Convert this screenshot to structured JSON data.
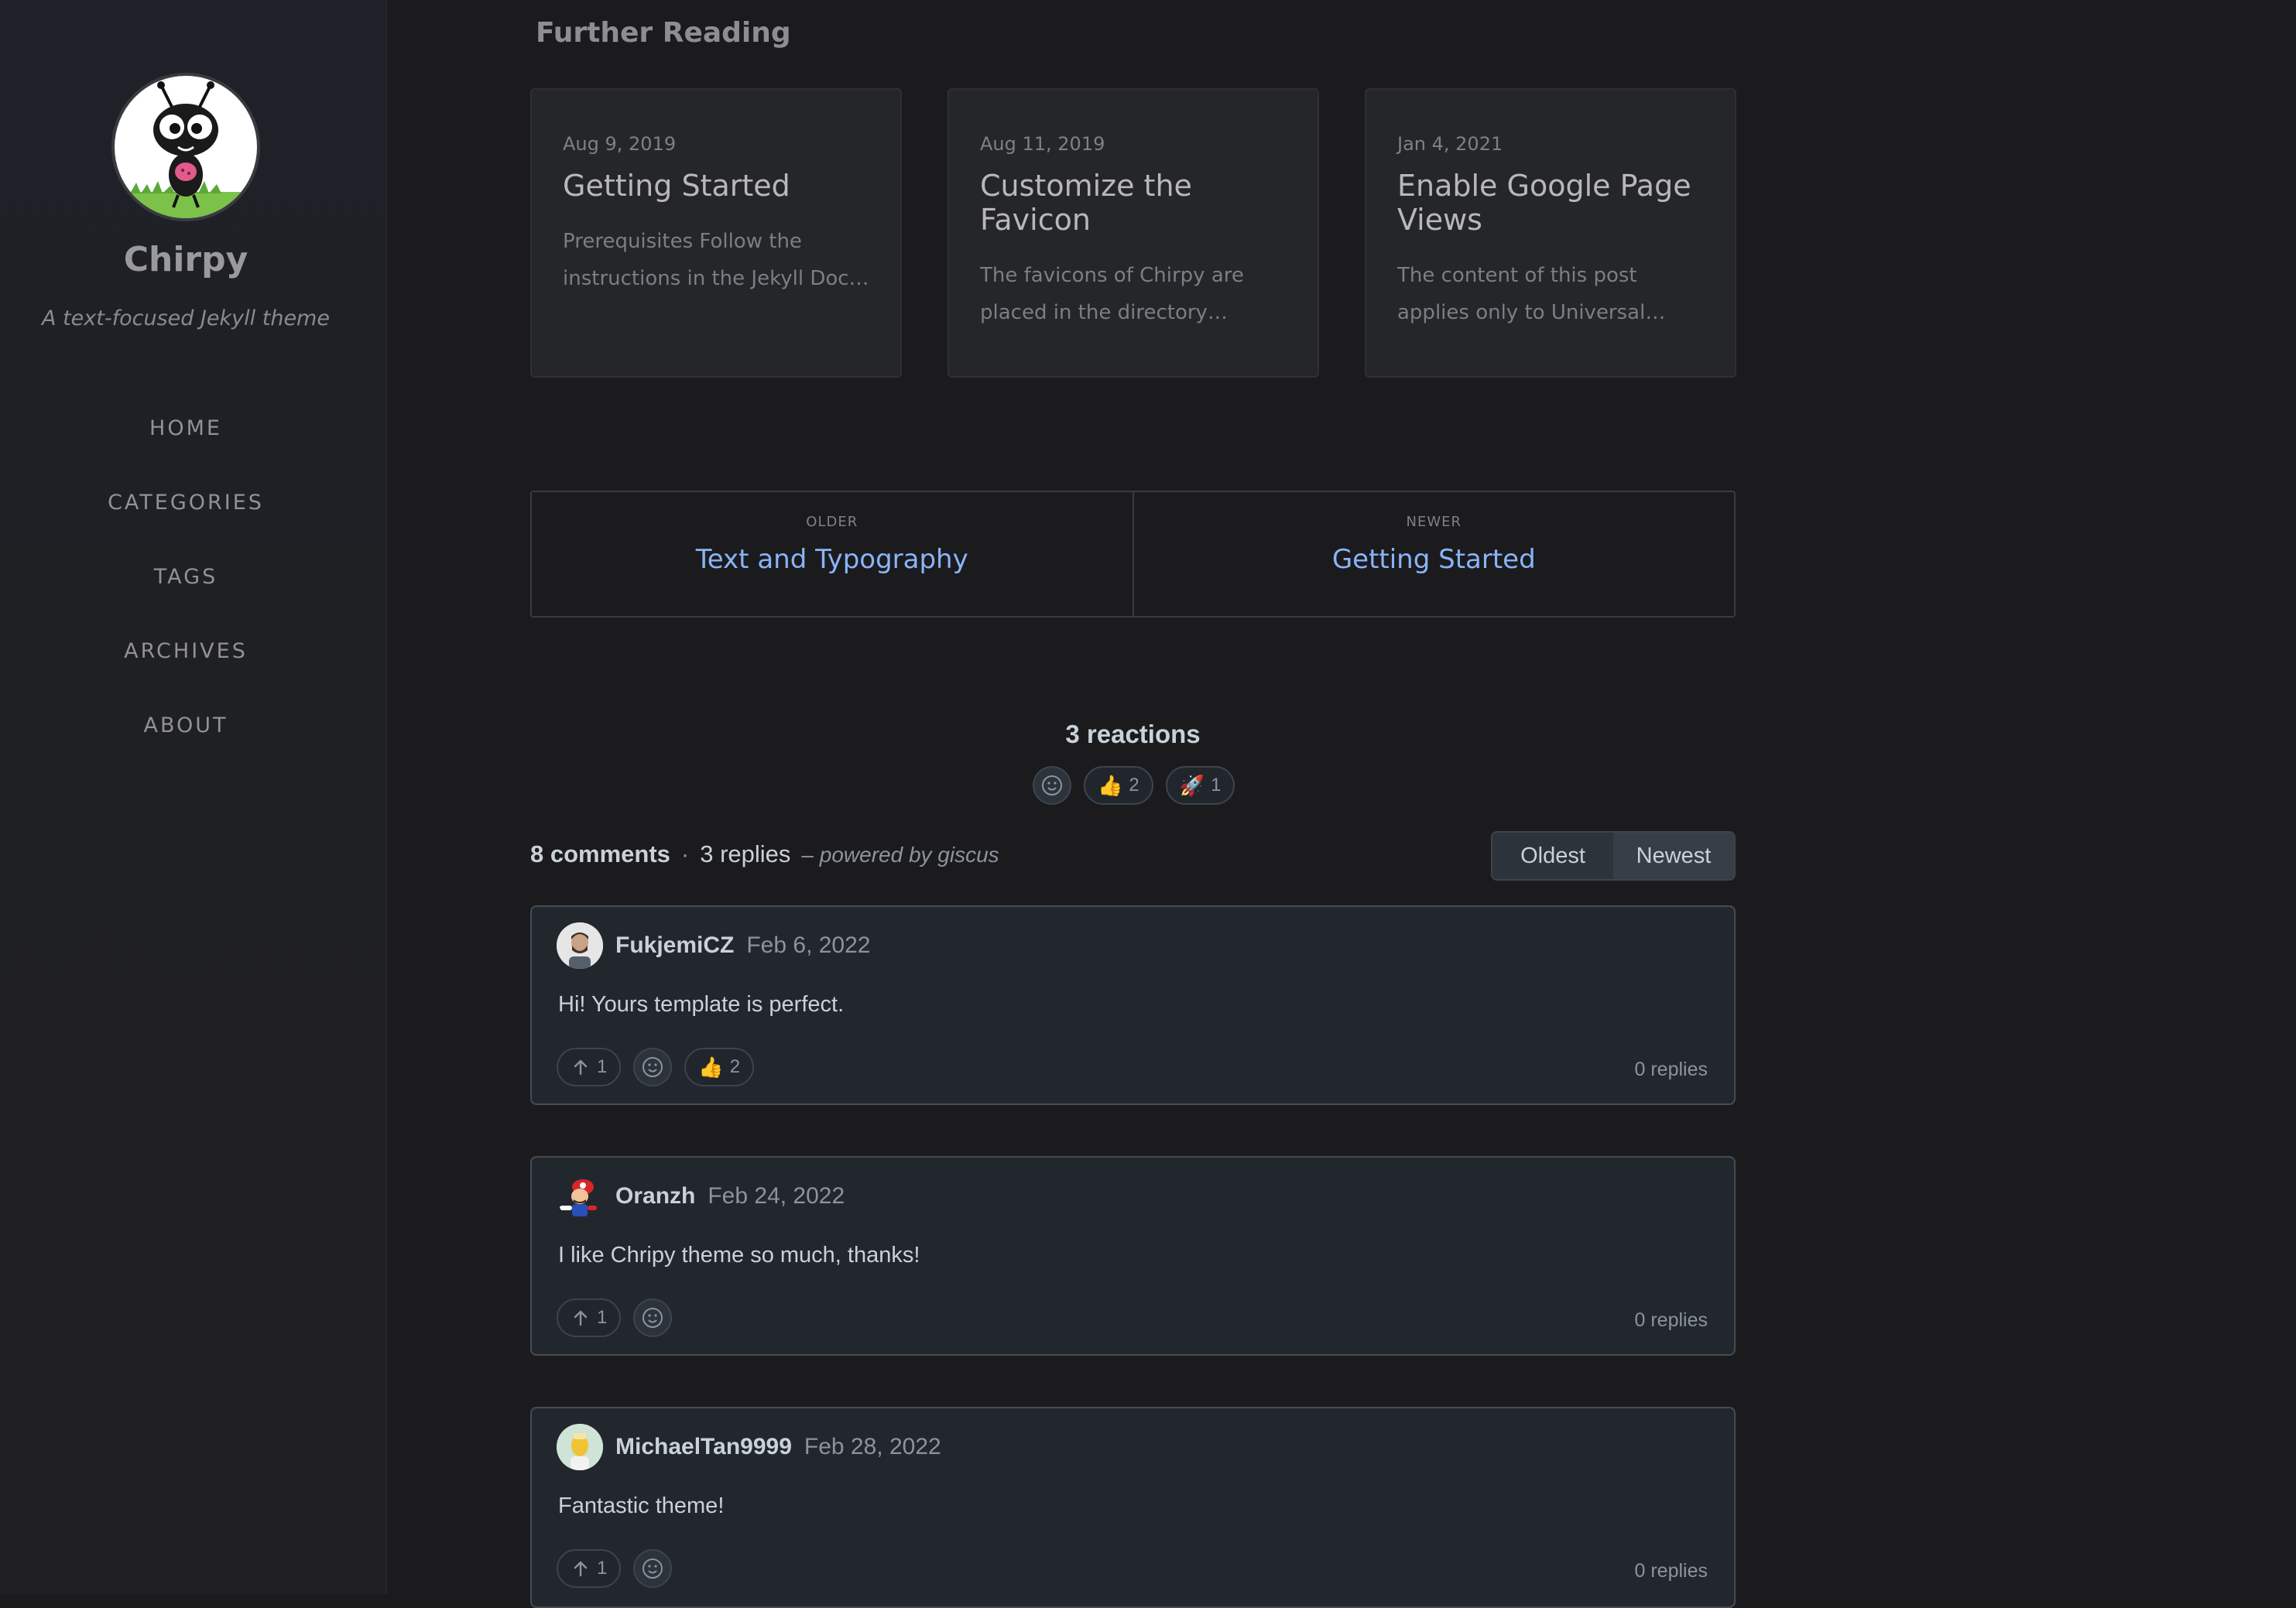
{
  "sidebar": {
    "title": "Chirpy",
    "subtitle": "A text-focused Jekyll theme",
    "nav": [
      "HOME",
      "CATEGORIES",
      "TAGS",
      "ARCHIVES",
      "ABOUT"
    ]
  },
  "further_reading": {
    "heading": "Further Reading",
    "cards": [
      {
        "date": "Aug 9, 2019",
        "title": "Getting Started",
        "excerpt": "Prerequisites Follow the instructions in the Jekyll Docs t…"
      },
      {
        "date": "Aug 11, 2019",
        "title": "Customize the Favicon",
        "excerpt": "The favicons of Chirpy are placed in the directory…"
      },
      {
        "date": "Jan 4, 2021",
        "title": "Enable Google Page Views",
        "excerpt": "The content of this post applies only to Universal Analytics…"
      }
    ]
  },
  "pager": {
    "older_label": "OLDER",
    "older_title": "Text and Typography",
    "newer_label": "NEWER",
    "newer_title": "Getting Started"
  },
  "reactions": {
    "title": "3 reactions",
    "items": [
      {
        "icon": "thumbs-up-icon",
        "emoji": "👍",
        "count": "2"
      },
      {
        "icon": "rocket-icon",
        "emoji": "🚀",
        "count": "1"
      }
    ]
  },
  "comments_header": {
    "count": "8 comments",
    "separator": "·",
    "replies": "3 replies",
    "powered": "– powered by giscus",
    "sort_oldest": "Oldest",
    "sort_newest": "Newest",
    "active_sort": "Newest"
  },
  "comments": [
    {
      "author": "FukjemiCZ",
      "date": "Feb 6, 2022",
      "body": "Hi! Yours template is perfect.",
      "upvotes": "1",
      "thumbs": "2",
      "replies": "0 replies"
    },
    {
      "author": "Oranzh",
      "date": "Feb 24, 2022",
      "body": "I like Chripy theme so much, thanks!",
      "upvotes": "1",
      "replies": "0 replies"
    },
    {
      "author": "MichaelTan9999",
      "date": "Feb 28, 2022",
      "body": "Fantastic theme!",
      "upvotes": "1",
      "replies": "0 replies"
    }
  ],
  "colors": {
    "background": "#1b1b1e",
    "link": "#8ab4f8",
    "comment_bg": "#22272e",
    "comment_border": "#444c56"
  }
}
